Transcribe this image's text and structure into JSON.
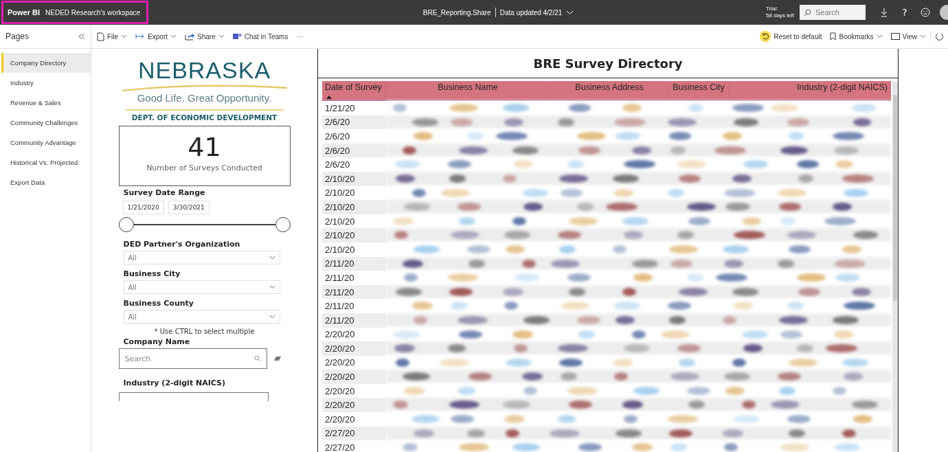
{
  "topbar": {
    "app": "Power BI",
    "workspace": "NEDED Research's workspace",
    "report": "BRE_Reporting.Share",
    "updated": "Data updated 4/2/21",
    "trial_line1": "Trial:",
    "trial_line2": "58 days left",
    "search": {
      "placeholder": "Search"
    },
    "help": "?"
  },
  "toolbar": {
    "pages_title": "Pages",
    "left": [
      {
        "kind": "file",
        "label": "File",
        "dropdown": true
      },
      {
        "kind": "export",
        "label": "Export",
        "dropdown": true
      },
      {
        "kind": "share",
        "label": "Share",
        "dropdown": true
      },
      {
        "kind": "teams",
        "label": "Chat in Teams",
        "dropdown": false
      }
    ],
    "more": "···",
    "right": [
      {
        "kind": "reset",
        "label": "Reset to default",
        "dropdown": false
      },
      {
        "kind": "bookmark",
        "label": "Bookmarks",
        "dropdown": true
      },
      {
        "kind": "view",
        "label": "View",
        "dropdown": true
      }
    ]
  },
  "pages": [
    {
      "label": "Company Directory",
      "selected": true
    },
    {
      "label": "Industry",
      "selected": false
    },
    {
      "label": "Revenue & Sales",
      "selected": false
    },
    {
      "label": "Community Challenges",
      "selected": false
    },
    {
      "label": "Community Advantage",
      "selected": false
    },
    {
      "label": "Historical Vs. Projected",
      "selected": false
    },
    {
      "label": "Export Data",
      "selected": false
    }
  ],
  "logo": {
    "name": "NEBRASKA",
    "tagline": "Good Life. Great Opportunity.",
    "dept": "DEPT. OF ECONOMIC DEVELOPMENT"
  },
  "card": {
    "value": "41",
    "label": "Number of Surveys Conducted"
  },
  "date_range": {
    "title": "Survey Date Range",
    "start": "1/21/2020",
    "end": "3/30/2021",
    "thumbs": [
      {
        "level": 0
      },
      {
        "level": 1
      }
    ]
  },
  "dropdowns": [
    {
      "title": "DED Partner's Organization",
      "value": "All"
    },
    {
      "title": "Business City",
      "value": "All"
    },
    {
      "title": "Business County",
      "value": "All"
    }
  ],
  "hint": "* Use CTRL to select multiple",
  "company": {
    "title": "Company Name",
    "placeholder": "Search"
  },
  "industry_filter": {
    "title": "Industry (2-digit NAICS)"
  },
  "table": {
    "title": "BRE Survey Directory",
    "columns": [
      "Date of Survey",
      "Business Name",
      "Business Address",
      "Business City",
      "Industry (2-digit NAICS)"
    ],
    "rows": [
      "1/21/20",
      "2/6/20",
      "2/6/20",
      "2/6/20",
      "2/6/20",
      "2/10/20",
      "2/10/20",
      "2/10/20",
      "2/10/20",
      "2/10/20",
      "2/10/20",
      "2/11/20",
      "2/11/20",
      "2/11/20",
      "2/11/20",
      "2/11/20",
      "2/20/20",
      "2/20/20",
      "2/20/20",
      "2/20/20",
      "2/20/20",
      "2/20/20",
      "2/20/20",
      "2/27/20",
      "2/27/20"
    ]
  }
}
